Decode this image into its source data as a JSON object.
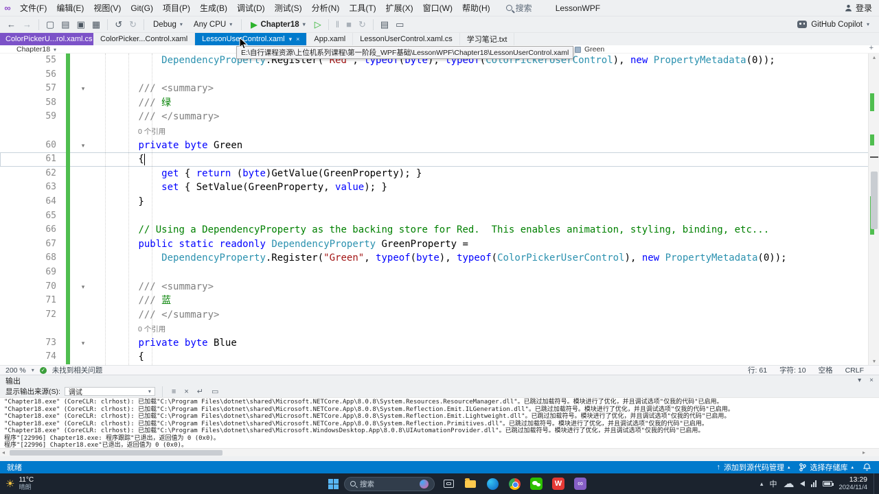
{
  "icons": {
    "chevron_down": "▾",
    "chevron_up": "▴",
    "close": "×",
    "back": "←",
    "forward": "→",
    "undo": "↺",
    "redo": "↻",
    "new_file": "▢",
    "open": "▤",
    "save": "▣",
    "save_all": "▦",
    "play": "▶",
    "play_outline": "▷",
    "pause": "‖",
    "stop": "■",
    "restart": "↻",
    "menu": "≡",
    "wrap": "↵",
    "panel": "▭",
    "up_arrow": "↑",
    "sun": "☀",
    "cloud": "☁",
    "check": "✓",
    "plus": "+",
    "infinity": "∞",
    "fold": "▾"
  },
  "title_bar": {
    "menus": [
      "文件(F)",
      "编辑(E)",
      "视图(V)",
      "Git(G)",
      "项目(P)",
      "生成(B)",
      "调试(D)",
      "测试(S)",
      "分析(N)",
      "工具(T)",
      "扩展(X)",
      "窗口(W)",
      "帮助(H)"
    ],
    "search": "搜索",
    "app_title": "LessonWPF",
    "sign_in": "登录"
  },
  "toolbar": {
    "config": "Debug",
    "platform": "Any CPU",
    "run_project": "Chapter18",
    "copilot": "GitHub Copilot"
  },
  "tab_bar": {
    "tabs": [
      {
        "label": "ColorPickerU...rol.xaml.cs",
        "style": "purple"
      },
      {
        "label": "ColorPicker...Control.xaml",
        "style": "normal"
      },
      {
        "label": "LessonUserControl.xaml",
        "style": "active"
      },
      {
        "label": "App.xaml",
        "style": "normal"
      },
      {
        "label": "LessonUserControl.xaml.cs",
        "style": "normal"
      },
      {
        "label": "学习笔记.txt",
        "style": "normal"
      }
    ]
  },
  "breadcrumb": {
    "project": "Chapter18",
    "member": "Green"
  },
  "tooltip": {
    "path": "E:\\自行课程资源\\上位机系列课程\\第一阶段_WPF基础\\LessonWPF\\Chapter18\\LessonUserControl.xaml"
  },
  "editor": {
    "lines": [
      {
        "n": "55",
        "seg": [
          [
            "            ",
            "p"
          ],
          [
            "DependencyProperty",
            "t"
          ],
          [
            ".Register(",
            "p"
          ],
          [
            "\"Red\"",
            "s"
          ],
          [
            ", ",
            "p"
          ],
          [
            "typeof",
            "k"
          ],
          [
            "(",
            "p"
          ],
          [
            "byte",
            "k"
          ],
          [
            "), ",
            "p"
          ],
          [
            "typeof",
            "k"
          ],
          [
            "(",
            "p"
          ],
          [
            "ColorPickerUserControl",
            "t"
          ],
          [
            "), ",
            "p"
          ],
          [
            "new",
            "k"
          ],
          [
            " ",
            "p"
          ],
          [
            "PropertyMetadata",
            "t"
          ],
          [
            "(0));",
            "p"
          ]
        ]
      },
      {
        "n": "56",
        "seg": []
      },
      {
        "n": "57",
        "f": 1,
        "seg": [
          [
            "        ",
            "p"
          ],
          [
            "/// <summary>",
            "dg"
          ]
        ]
      },
      {
        "n": "58",
        "seg": [
          [
            "        ",
            "p"
          ],
          [
            "/// ",
            "dg"
          ],
          [
            "绿",
            "c"
          ]
        ]
      },
      {
        "n": "59",
        "seg": [
          [
            "        ",
            "p"
          ],
          [
            "/// </summary>",
            "dg"
          ]
        ]
      },
      {
        "n": "",
        "lens": "0 个引用"
      },
      {
        "n": "60",
        "f": 1,
        "seg": [
          [
            "        ",
            "p"
          ],
          [
            "private",
            "k"
          ],
          [
            " ",
            "p"
          ],
          [
            "byte",
            "k"
          ],
          [
            " Green",
            "p"
          ]
        ]
      },
      {
        "n": "61",
        "cur": 1,
        "seg": [
          [
            "        {",
            "p"
          ]
        ]
      },
      {
        "n": "62",
        "seg": [
          [
            "            ",
            "p"
          ],
          [
            "get",
            "k"
          ],
          [
            " { ",
            "p"
          ],
          [
            "return",
            "k"
          ],
          [
            " (",
            "p"
          ],
          [
            "byte",
            "k"
          ],
          [
            ")GetValue(GreenProperty); }",
            "p"
          ]
        ]
      },
      {
        "n": "63",
        "seg": [
          [
            "            ",
            "p"
          ],
          [
            "set",
            "k"
          ],
          [
            " { SetValue(GreenProperty, ",
            "p"
          ],
          [
            "value",
            "k"
          ],
          [
            "); }",
            "p"
          ]
        ]
      },
      {
        "n": "64",
        "seg": [
          [
            "        }",
            "p"
          ]
        ]
      },
      {
        "n": "65",
        "seg": []
      },
      {
        "n": "66",
        "seg": [
          [
            "        ",
            "p"
          ],
          [
            "// Using a DependencyProperty as the backing store for Red.  This enables animation, styling, binding, etc...",
            "c"
          ]
        ]
      },
      {
        "n": "67",
        "seg": [
          [
            "        ",
            "p"
          ],
          [
            "public",
            "k"
          ],
          [
            " ",
            "p"
          ],
          [
            "static",
            "k"
          ],
          [
            " ",
            "p"
          ],
          [
            "readonly",
            "k"
          ],
          [
            " ",
            "p"
          ],
          [
            "DependencyProperty",
            "t"
          ],
          [
            " GreenProperty =",
            "p"
          ]
        ]
      },
      {
        "n": "68",
        "seg": [
          [
            "            ",
            "p"
          ],
          [
            "DependencyProperty",
            "t"
          ],
          [
            ".Register(",
            "p"
          ],
          [
            "\"Green\"",
            "s"
          ],
          [
            ", ",
            "p"
          ],
          [
            "typeof",
            "k"
          ],
          [
            "(",
            "p"
          ],
          [
            "byte",
            "k"
          ],
          [
            "), ",
            "p"
          ],
          [
            "typeof",
            "k"
          ],
          [
            "(",
            "p"
          ],
          [
            "ColorPickerUserControl",
            "t"
          ],
          [
            "), ",
            "p"
          ],
          [
            "new",
            "k"
          ],
          [
            " ",
            "p"
          ],
          [
            "PropertyMetadata",
            "t"
          ],
          [
            "(0));",
            "p"
          ]
        ]
      },
      {
        "n": "69",
        "seg": []
      },
      {
        "n": "70",
        "f": 1,
        "seg": [
          [
            "        ",
            "p"
          ],
          [
            "/// <summary>",
            "dg"
          ]
        ]
      },
      {
        "n": "71",
        "seg": [
          [
            "        ",
            "p"
          ],
          [
            "/// ",
            "dg"
          ],
          [
            "蓝",
            "c"
          ]
        ]
      },
      {
        "n": "72",
        "seg": [
          [
            "        ",
            "p"
          ],
          [
            "/// </summary>",
            "dg"
          ]
        ]
      },
      {
        "n": "",
        "lens": "0 个引用"
      },
      {
        "n": "73",
        "f": 1,
        "seg": [
          [
            "        ",
            "p"
          ],
          [
            "private",
            "k"
          ],
          [
            " ",
            "p"
          ],
          [
            "byte",
            "k"
          ],
          [
            " Blue",
            "p"
          ]
        ]
      },
      {
        "n": "74",
        "seg": [
          [
            "        {",
            "p"
          ]
        ]
      }
    ]
  },
  "editor_status": {
    "zoom": "200 %",
    "health": "未找到相关问题",
    "line": "行: 61",
    "column": "字符: 10",
    "spaces": "空格",
    "line_ending": "CRLF"
  },
  "output": {
    "title": "输出",
    "source_label": "显示输出来源(S):",
    "source_value": "调试",
    "lines": [
      "\"Chapter18.exe\" (CoreCLR: clrhost): 已加载\"C:\\Program Files\\dotnet\\shared\\Microsoft.NETCore.App\\8.0.8\\System.Resources.ResourceManager.dll\"。已跳过加载符号。模块进行了优化，并且调试选项\"仅我的代码\"已启用。",
      "\"Chapter18.exe\" (CoreCLR: clrhost): 已加载\"C:\\Program Files\\dotnet\\shared\\Microsoft.NETCore.App\\8.0.8\\System.Reflection.Emit.ILGeneration.dll\"。已跳过加载符号。模块进行了优化，并且调试选项\"仅我的代码\"已启用。",
      "\"Chapter18.exe\" (CoreCLR: clrhost): 已加载\"C:\\Program Files\\dotnet\\shared\\Microsoft.NETCore.App\\8.0.8\\System.Reflection.Emit.Lightweight.dll\"。已跳过加载符号。模块进行了优化，并且调试选项\"仅我的代码\"已启用。",
      "\"Chapter18.exe\" (CoreCLR: clrhost): 已加载\"C:\\Program Files\\dotnet\\shared\\Microsoft.NETCore.App\\8.0.8\\System.Reflection.Primitives.dll\"。已跳过加载符号。模块进行了优化，并且调试选项\"仅我的代码\"已启用。",
      "\"Chapter18.exe\" (CoreCLR: clrhost): 已加载\"C:\\Program Files\\dotnet\\shared\\Microsoft.WindowsDesktop.App\\8.0.8\\UIAutomationProvider.dll\"。已跳过加载符号。模块进行了优化，并且调试选项\"仅我的代码\"已启用。",
      "程序\"[22996] Chapter18.exe: 程序跟踪\"已退出，返回值为 0 (0x0)。",
      "程序\"[22996] Chapter18.exe\"已退出，返回值为 0 (0x0)。"
    ]
  },
  "status_bar": {
    "ready": "就绪",
    "add_to_source_control": "添加到源代码管理",
    "select_repository": "选择存储库"
  },
  "taskbar": {
    "weather_temp": "11°C",
    "weather_desc": "晴朗",
    "search_placeholder": "搜索",
    "ime": "中",
    "time": "13:29",
    "date": "2024/11/4"
  }
}
